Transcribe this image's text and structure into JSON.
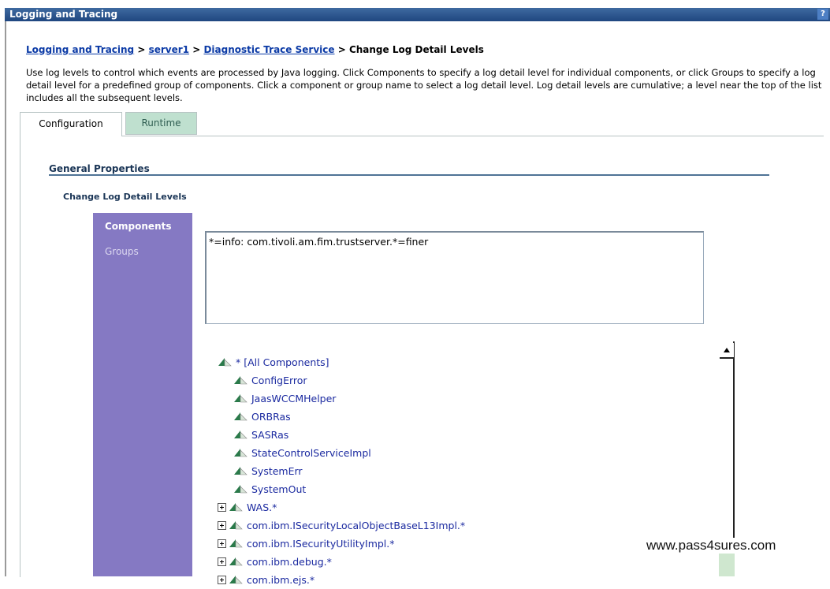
{
  "window": {
    "title": "Logging and Tracing",
    "help_label": "?"
  },
  "breadcrumb": {
    "items": [
      "Logging and Tracing",
      "server1",
      "Diagnostic Trace Service"
    ],
    "current": "Change Log Detail Levels",
    "separator": ">"
  },
  "description": "Use log levels to control which events are processed by Java logging. Click Components to specify a log detail level for individual components, or click Groups to specify a log detail level for a predefined group of components. Click a component or group name to select a log detail level. Log detail levels are cumulative; a level near the top of the list includes all the subsequent levels.",
  "tabs": [
    {
      "label": "Configuration",
      "active": true
    },
    {
      "label": "Runtime",
      "active": false
    }
  ],
  "general_properties": {
    "title": "General Properties",
    "section": "Change Log Detail Levels"
  },
  "sidenav": {
    "items": [
      {
        "label": "Components",
        "active": true
      },
      {
        "label": "Groups",
        "active": false
      }
    ]
  },
  "log_spec": {
    "value": "*=info: com.tivoli.am.fim.trustserver.*=finer"
  },
  "tree": {
    "root": "* [All Components]",
    "items": [
      {
        "label": "ConfigError",
        "expandable": false
      },
      {
        "label": "JaasWCCMHelper",
        "expandable": false
      },
      {
        "label": "ORBRas",
        "expandable": false
      },
      {
        "label": "SASRas",
        "expandable": false
      },
      {
        "label": "StateControlServiceImpl",
        "expandable": false
      },
      {
        "label": "SystemErr",
        "expandable": false
      },
      {
        "label": "SystemOut",
        "expandable": false
      },
      {
        "label": "WAS.*",
        "expandable": true
      },
      {
        "label": "com.ibm.ISecurityLocalObjectBaseL13Impl.*",
        "expandable": true
      },
      {
        "label": "com.ibm.ISecurityUtilityImpl.*",
        "expandable": true
      },
      {
        "label": "com.ibm.debug.*",
        "expandable": true
      },
      {
        "label": "com.ibm.ejs.*",
        "expandable": true
      }
    ]
  },
  "watermark": "www.pass4sures.com",
  "colors": {
    "title_bar": "#1f4780",
    "link": "#0b3aa6",
    "sidenav": "#8579c3",
    "runtime_tab": "#bfe0cf",
    "tree_label": "#1b2aa0"
  }
}
